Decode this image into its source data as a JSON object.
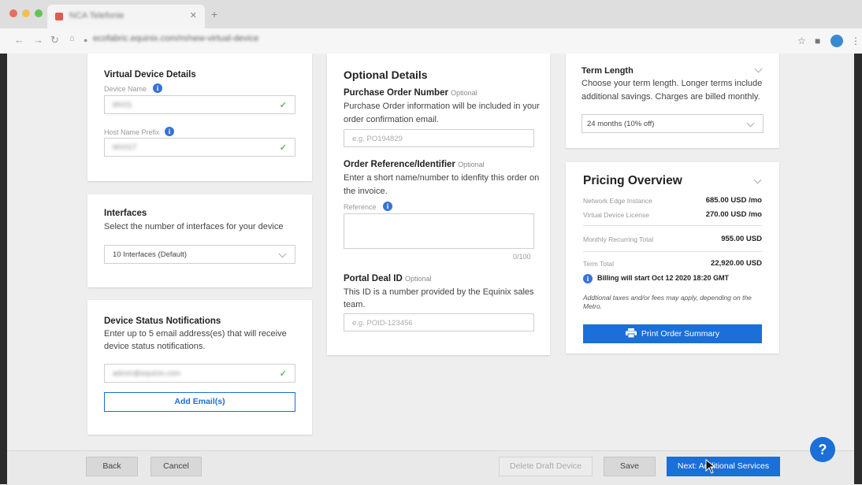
{
  "browser": {
    "tab_title": "NCA Telefonie",
    "url": "ecofabric.equinix.com/m/new-virtual-device"
  },
  "virtual_device": {
    "heading": "Virtual Device Details",
    "device_name_label": "Device Name",
    "device_name_value": "MV01",
    "host_prefix_label": "Host Name Prefix",
    "host_prefix_value": "MV01T"
  },
  "interfaces": {
    "heading": "Interfaces",
    "description": "Select the number of interfaces for your device",
    "selected": "10 Interfaces (Default)"
  },
  "notifications": {
    "heading": "Device Status Notifications",
    "description_line1": "Enter up to 5 email address(es) that will receive",
    "description_line2": "device status notifications.",
    "email_value": "admin@equinix.com",
    "add_button": "Add Email(s)"
  },
  "optional": {
    "heading": "Optional Details",
    "po_heading": "Purchase Order Number",
    "optional_tag": "Optional",
    "po_desc_line1": "Purchase Order information will be included in your",
    "po_desc_line2": "order confirmation email.",
    "po_placeholder": "e.g. PO194829",
    "ref_heading": "Order Reference/Identifier",
    "ref_desc_line1": "Enter a short name/number to idenfity this order on",
    "ref_desc_line2": "the invoice.",
    "ref_label": "Reference",
    "ref_counter": "0/100",
    "deal_heading": "Portal Deal ID",
    "deal_desc_line1": "This ID is a number provided by the Equinix sales",
    "deal_desc_line2": "team.",
    "deal_placeholder": "e.g. POID-123456"
  },
  "term": {
    "heading": "Term Length",
    "desc_line1": "Choose your term length. Longer terms include",
    "desc_line2": "additional savings. Charges are billed monthly.",
    "selected": "24 months (10% off)"
  },
  "pricing": {
    "heading": "Pricing Overview",
    "rows": [
      {
        "label": "Network Edge Instance",
        "value": "685.00 USD /mo"
      },
      {
        "label": "Virtual Device License",
        "value": "270.00 USD /mo"
      }
    ],
    "monthly_label": "Monthly Recurring Total",
    "monthly_value": "955.00 USD",
    "term_label": "Term Total",
    "term_value": "22,920.00 USD",
    "billing_note": "Billing will start Oct 12 2020 18:20 GMT",
    "tax_note_line1": "Addtional taxes and/or fees may apply, depending on the",
    "tax_note_line2": "Metro.",
    "print_button": "Print Order Summary"
  },
  "footer": {
    "back": "Back",
    "cancel": "Cancel",
    "delete_draft": "Delete Draft Device",
    "save": "Save",
    "next": "Next: Additional Services"
  },
  "help": "?",
  "colors": {
    "primary": "#1a6fd8",
    "info": "#3573d8",
    "success": "#5fb760"
  }
}
